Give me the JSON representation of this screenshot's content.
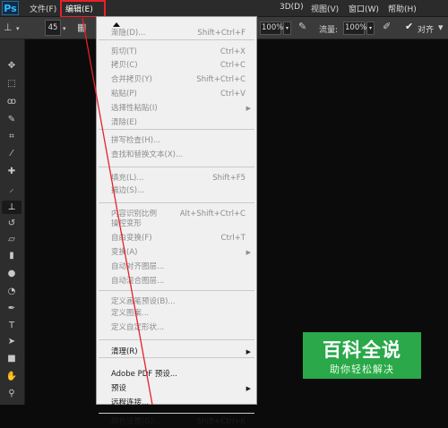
{
  "app": {
    "logo": "Ps"
  },
  "menubar": {
    "items": [
      "文件(F)",
      "编辑(E)",
      "3D(D)",
      "视图(V)",
      "窗口(W)",
      "帮助(H)"
    ],
    "active": "编辑(E)"
  },
  "options": {
    "brush_size": "45",
    "opacity_value": "100%",
    "flow_label": "流量:",
    "flow_value": "100%",
    "align_label": "对齐"
  },
  "edit_menu": [
    {
      "label": "渐隐(D)...",
      "shortcut": "Shift+Ctrl+F",
      "disabled": true
    },
    {
      "sep": true
    },
    {
      "label": "剪切(T)",
      "shortcut": "Ctrl+X",
      "disabled": true
    },
    {
      "label": "拷贝(C)",
      "shortcut": "Ctrl+C",
      "disabled": true
    },
    {
      "label": "合并拷贝(Y)",
      "shortcut": "Shift+Ctrl+C",
      "disabled": true
    },
    {
      "label": "粘贴(P)",
      "shortcut": "Ctrl+V",
      "disabled": true
    },
    {
      "label": "选择性粘贴(I)",
      "submenu": true,
      "disabled": true
    },
    {
      "label": "清除(E)",
      "disabled": true
    },
    {
      "sep": true
    },
    {
      "label": "拼写检查(H)...",
      "disabled": true
    },
    {
      "label": "查找和替换文本(X)...",
      "disabled": true
    },
    {
      "sep": true
    },
    {
      "label": "填充(L)...",
      "shortcut": "Shift+F5",
      "disabled": true
    },
    {
      "label": "描边(S)...",
      "disabled": true
    },
    {
      "sep": true
    },
    {
      "label": "内容识别比例",
      "shortcut": "Alt+Shift+Ctrl+C",
      "disabled": true
    },
    {
      "label": "操控变形",
      "disabled": true
    },
    {
      "label": "自由变换(F)",
      "shortcut": "Ctrl+T",
      "disabled": true
    },
    {
      "label": "变换(A)",
      "submenu": true,
      "disabled": true
    },
    {
      "label": "自动对齐图层...",
      "disabled": true
    },
    {
      "label": "自动混合图层...",
      "disabled": true
    },
    {
      "sep": true
    },
    {
      "label": "定义画笔预设(B)...",
      "disabled": true
    },
    {
      "label": "定义图案...",
      "disabled": true
    },
    {
      "label": "定义自定形状...",
      "disabled": true
    },
    {
      "sep": true
    },
    {
      "label": "清理(R)",
      "submenu": true,
      "disabled": false
    },
    {
      "sep": true
    },
    {
      "label": "Adobe PDF 预设...",
      "disabled": false
    },
    {
      "label": "预设",
      "submenu": true,
      "disabled": false
    },
    {
      "label": "远程连接...",
      "disabled": false
    },
    {
      "sep": true
    },
    {
      "label": "颜色设置(G)...",
      "shortcut": "Shift+Ctrl+K",
      "disabled": false
    }
  ],
  "watermark": {
    "title": "百科全说",
    "subtitle": "助你轻松解决"
  },
  "colors": {
    "highlight": "#e8202a",
    "watermark_bg": "#2aa84a"
  }
}
